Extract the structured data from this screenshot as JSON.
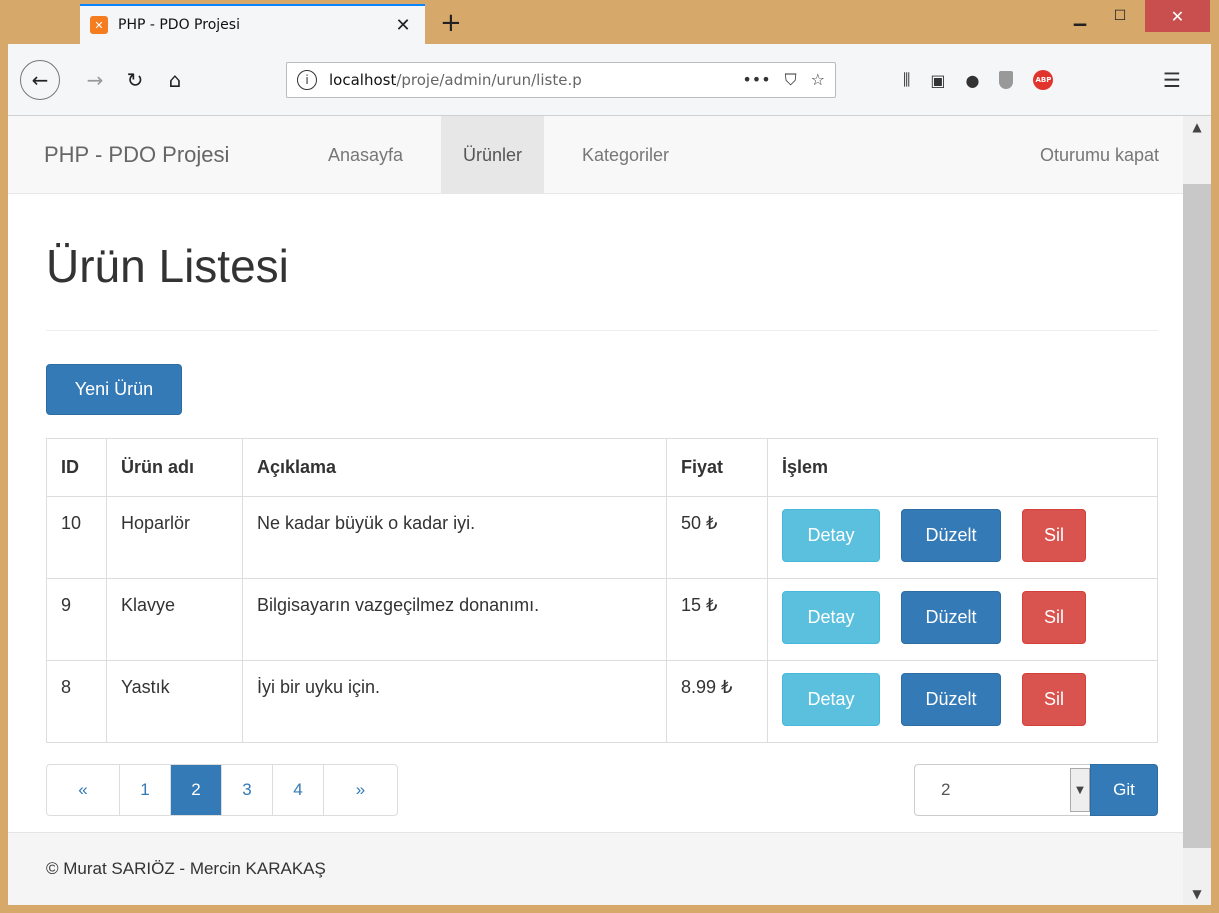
{
  "browser": {
    "tab_title": "PHP - PDO Projesi",
    "tab_favicon": "xampp-icon",
    "url_host": "localhost",
    "url_path": "/proje/admin/urun/liste.p",
    "window_controls": [
      "minimize-icon",
      "maximize-icon",
      "close-icon"
    ]
  },
  "site": {
    "brand": "PHP - PDO Projesi",
    "nav": [
      {
        "label": "Anasayfa",
        "active": false
      },
      {
        "label": "Ürünler",
        "active": true
      },
      {
        "label": "Kategoriler",
        "active": false
      }
    ],
    "logout": "Oturumu kapat"
  },
  "main": {
    "title": "Ürün Listesi",
    "new_button": "Yeni Ürün",
    "table": {
      "headers": [
        "ID",
        "Ürün adı",
        "Açıklama",
        "Fiyat",
        "İşlem"
      ],
      "rows": [
        {
          "id": "10",
          "name": "Hoparlör",
          "desc": "Ne kadar büyük o kadar iyi.",
          "price": "50 ₺"
        },
        {
          "id": "9",
          "name": "Klavye",
          "desc": "Bilgisayarın vazgeçilmez donanımı.",
          "price": "15 ₺"
        },
        {
          "id": "8",
          "name": "Yastık",
          "desc": "İyi bir uyku için.",
          "price": "8.99 ₺"
        }
      ],
      "actions": {
        "detail": "Detay",
        "edit": "Düzelt",
        "delete": "Sil"
      }
    },
    "pagination": {
      "prev": "«",
      "pages": [
        "1",
        "2",
        "3",
        "4"
      ],
      "current": "2",
      "next": "»"
    },
    "goto": {
      "selected": "2",
      "button": "Git"
    }
  },
  "footer": {
    "text": "© Murat SARIÖZ - Mercin KARAKAŞ"
  },
  "colors": {
    "primary": "#337ab7",
    "info": "#5bc0de",
    "danger": "#d9534f",
    "frame": "#d6a96b"
  }
}
